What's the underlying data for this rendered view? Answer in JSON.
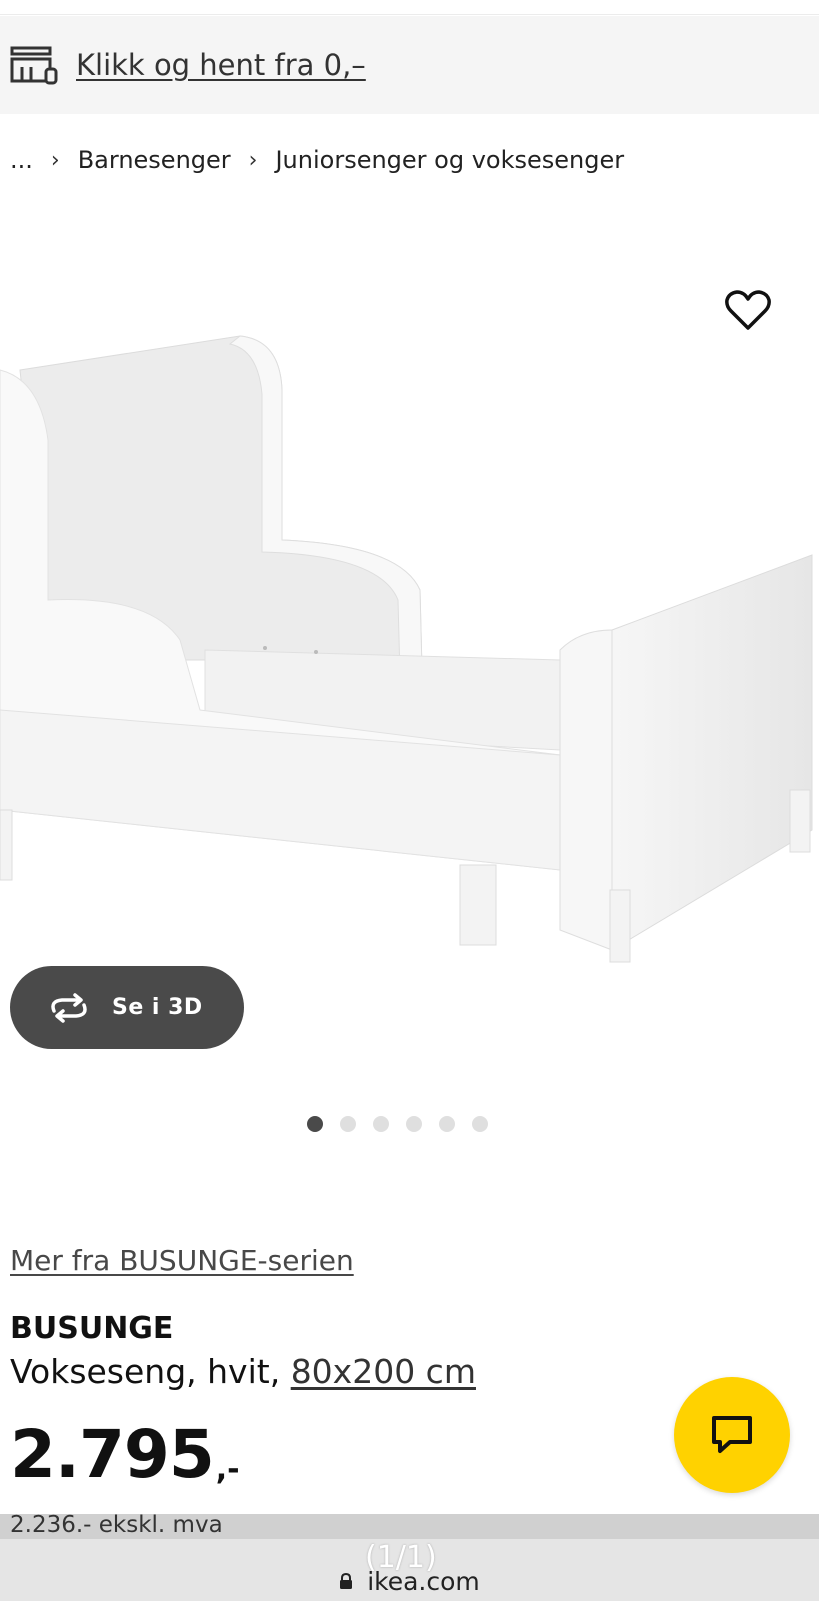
{
  "banner": {
    "icon": "store-icon",
    "text": "Klikk og hent fra 0,–"
  },
  "breadcrumb": {
    "ellipsis": "...",
    "items": [
      "Barnesenger",
      "Juniorsenger og voksesenger"
    ]
  },
  "product_image": {
    "favorite_icon": "heart-icon"
  },
  "view3d": {
    "icon": "rotate-icon",
    "label": "Se i 3D"
  },
  "carousel": {
    "count": 6,
    "active_index": 0
  },
  "series_link": "Mer fra BUSUNGE-serien",
  "product": {
    "name": "BUSUNGE",
    "desc_prefix": "Vokseseng, hvit,",
    "size": "80x200 cm",
    "price_main": "2.795",
    "price_suffix": ",-",
    "price_ex_vat": "2.236.- ekskl. mva"
  },
  "chat": {
    "icon": "chat-bubble-icon"
  },
  "browser": {
    "page_count": "(1/1)",
    "url": "ikea.com",
    "lock_icon": "lock-icon"
  },
  "colors": {
    "brand_yellow": "#ffd200",
    "dark_button": "#4a4a4a",
    "banner_bg": "#f5f5f5"
  }
}
